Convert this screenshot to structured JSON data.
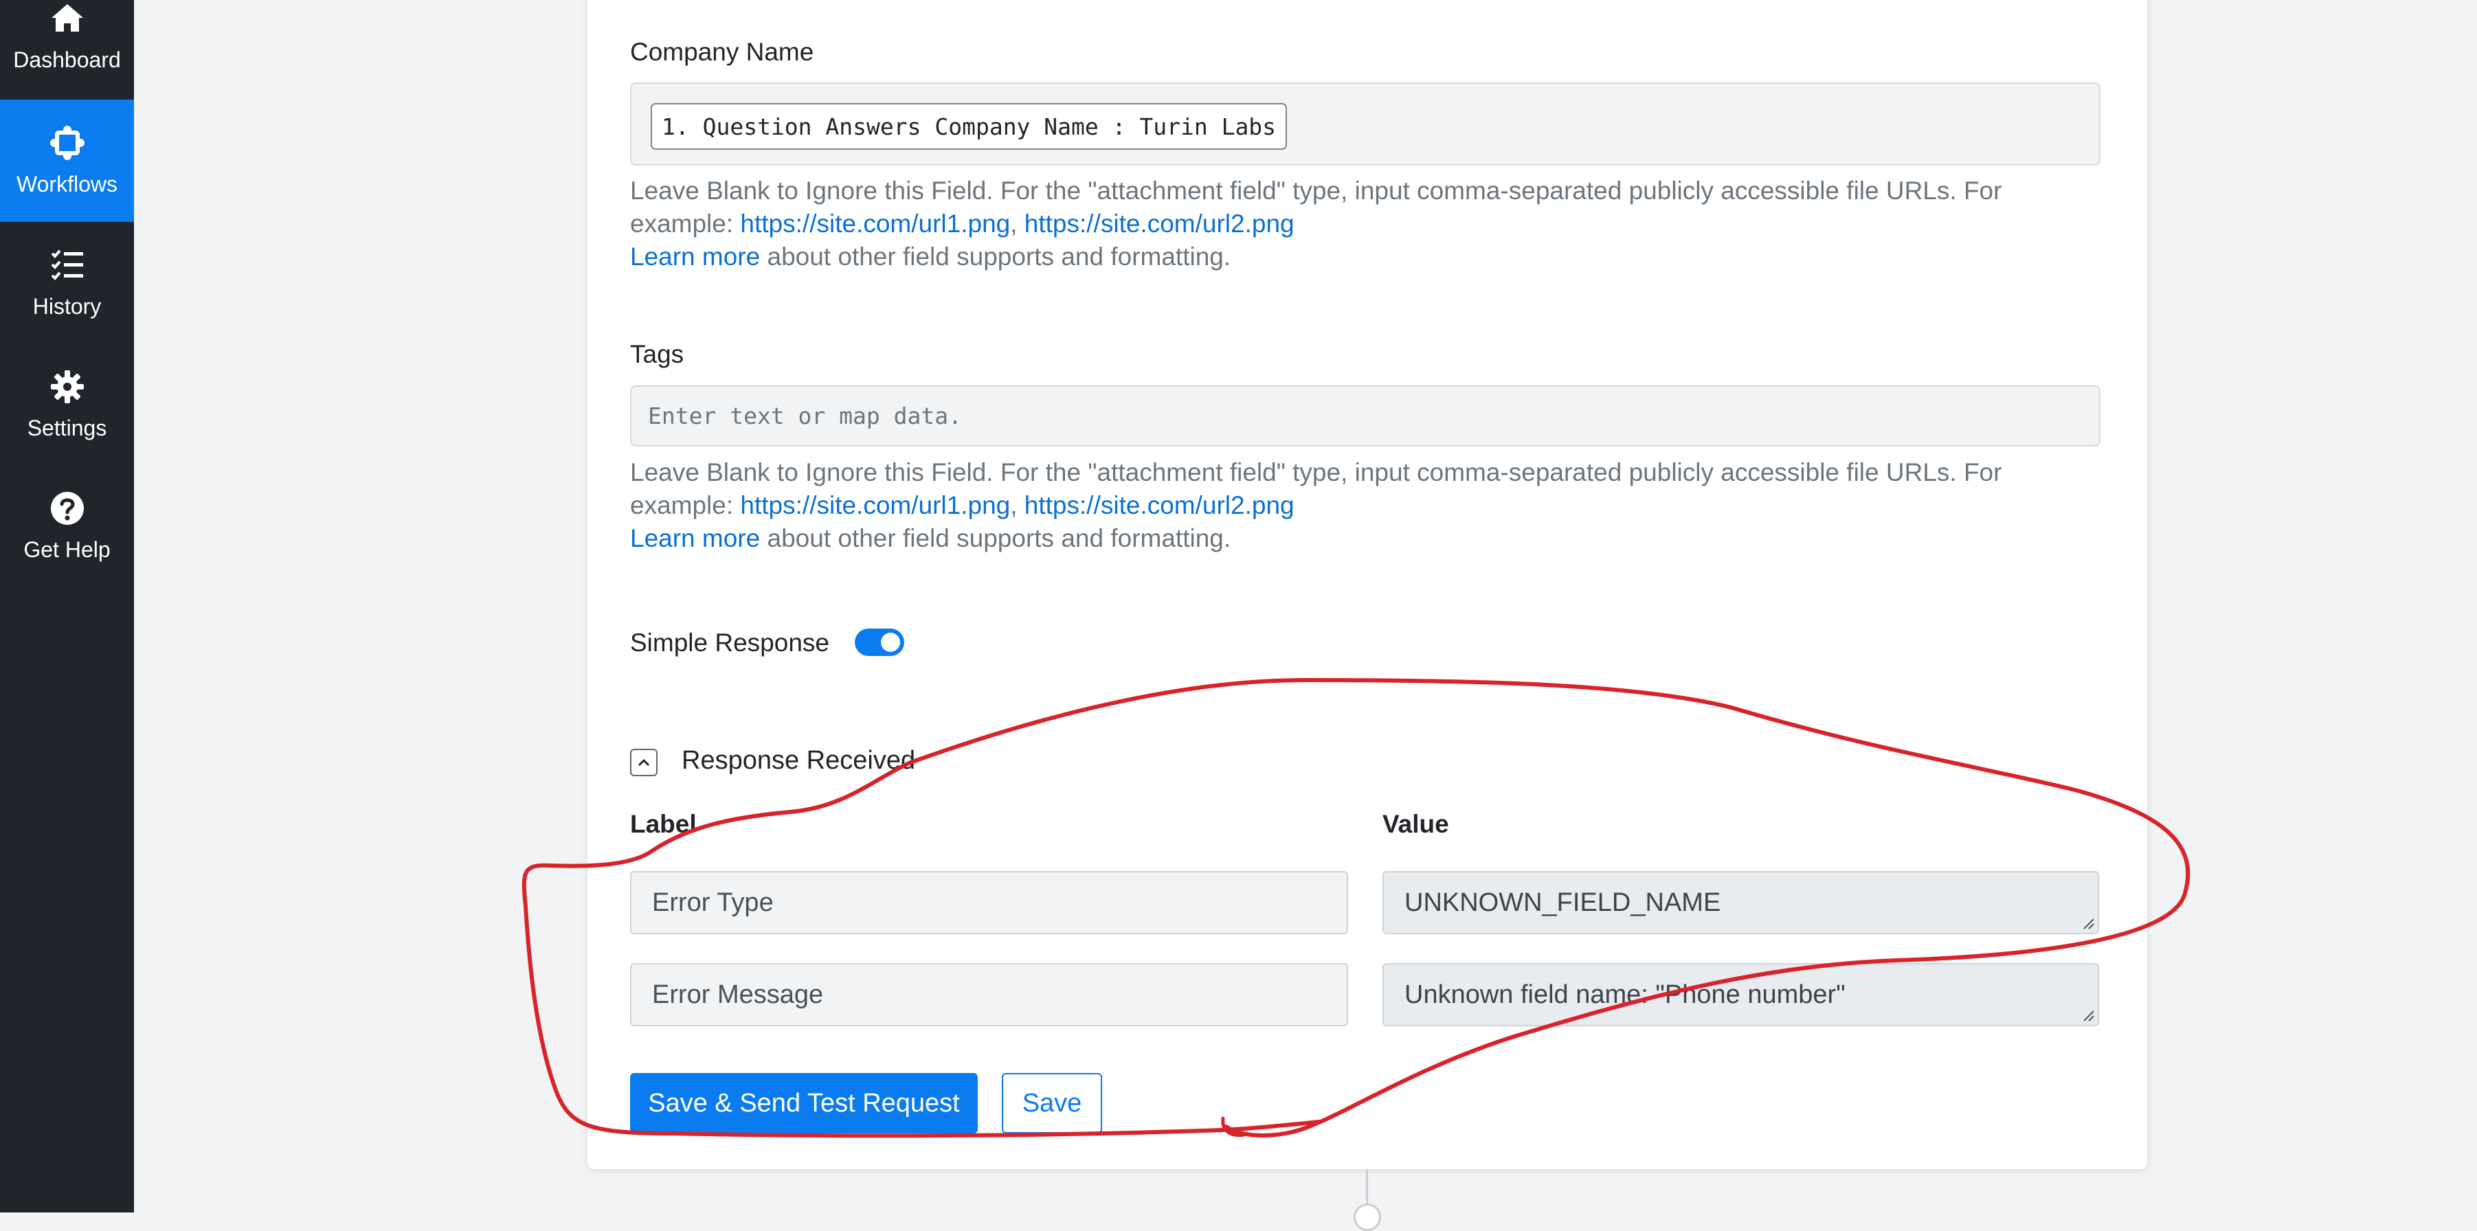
{
  "sidebar": {
    "items": [
      {
        "label": "Dashboard",
        "icon": "home-icon"
      },
      {
        "label": "Workflows",
        "icon": "workflows-icon",
        "active": true
      },
      {
        "label": "History",
        "icon": "history-list-icon"
      },
      {
        "label": "Settings",
        "icon": "gear-icon"
      },
      {
        "label": "Get Help",
        "icon": "question-circle-icon"
      }
    ]
  },
  "form": {
    "company_name": {
      "label": "Company Name",
      "value": "1. Question Answers Company Name : Turin Labs"
    },
    "tags": {
      "label": "Tags",
      "placeholder": "Enter text or map data."
    },
    "help": {
      "line1": "Leave Blank to Ignore this Field. For the \"attachment field\" type, input comma-separated publicly accessible file URLs. For",
      "example_prefix": "example: ",
      "url1": "https://site.com/url1.png",
      "separator": ", ",
      "url2": "https://site.com/url2.png",
      "learn_more": "Learn more",
      "learn_more_suffix": " about other field supports and formatting."
    },
    "simple_response": {
      "label": "Simple Response",
      "enabled": true
    },
    "response_received": {
      "title": "Response Received",
      "label_header": "Label",
      "value_header": "Value",
      "rows": [
        {
          "label": "Error Type",
          "value": "UNKNOWN_FIELD_NAME"
        },
        {
          "label": "Error Message",
          "value": "Unknown field name: \"Phone number\""
        }
      ]
    },
    "buttons": {
      "save_and_test": "Save & Send Test Request",
      "save": "Save"
    }
  },
  "colors": {
    "sidebar_bg": "#1f252b",
    "accent": "#0a7cf0",
    "annotation_red": "#d8232a"
  }
}
